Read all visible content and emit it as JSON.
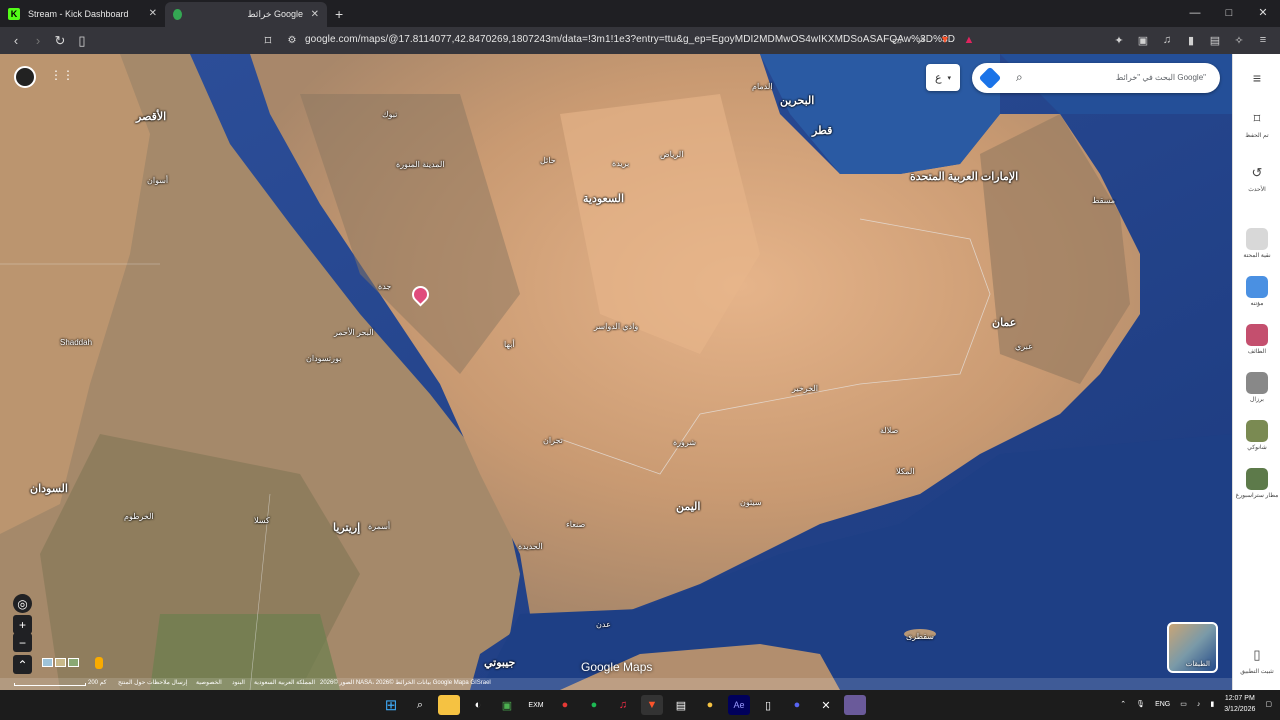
{
  "browser": {
    "tabs": [
      {
        "title": "Stream - Kick Dashboard",
        "favicon": "kick-icon",
        "active": false
      },
      {
        "title": "خرائط Google",
        "favicon": "google-maps-icon",
        "active": true
      }
    ],
    "new_tab": "+",
    "window_controls": {
      "minimize": "—",
      "maximize": "□",
      "close": "✕"
    },
    "url": "google.com/maps/@17.8114077,42.8470269,1807243m/data=!3m1!1e3?entry=ttu&g_ep=EgoyMDI2MDMwOS4wIKXMDSoASAFQAw%3D%3D"
  },
  "maps": {
    "search_placeholder": "البحث في \"خرائط Google\"",
    "lang_chip": "ع",
    "brand": "Google Maps",
    "layers_label": "الطبقات",
    "footer": {
      "scale": "200 كم",
      "imagery": "الصور ©2026 NASA، بيانات الخرائط ©2026 Google Mapa GISrael",
      "terms": "المملكة العربية السعودية",
      "terms2": "البنود",
      "privacy": "الخصوصية",
      "feedback": "إرسال ملاحظات حول المنتج"
    },
    "labels": {
      "saudi": "السعودية",
      "uae": "الإمارات العربية المتحدة",
      "oman": "عمان",
      "yemen": "اليمن",
      "sudan": "السودان",
      "eritrea": "إريتريا",
      "bahrain": "البحرين",
      "qatar": "قطر",
      "riyadh": "الرياض",
      "medina": "المدينة المنورة",
      "dammam": "الدمام",
      "muscat": "مسقط",
      "sanaa": "صنعاء",
      "aden": "عدن",
      "khartoum": "الخرطوم",
      "asmara": "أسمرة",
      "djibouti": "جيبوتي",
      "redsea": "البحر الأحمر",
      "luxor": "الأقصر",
      "aswan": "أسوان",
      "portsudan": "بورتسودان",
      "jeddah": "جدة",
      "abha": "أبها",
      "najran": "نجران",
      "salalah": "صلالة",
      "mukalla": "المكلا",
      "shaddah": "Shaddah",
      "socotra": "سقطرى",
      "hodeidah": "الحديدة",
      "seiyun": "سيئون",
      "ibri": "عبري",
      "sharurah": "شرورة",
      "wadi": "وادي الدواسر",
      "kharkhir": "الخرخير",
      "tabuk": "تبوك",
      "hail": "حائل",
      "buraydah": "بريدة",
      "kassala": "كسلا"
    }
  },
  "sidebar": {
    "menu": "≡",
    "items": [
      {
        "label": "تم الحفظ",
        "icon": "bookmark-icon"
      },
      {
        "label": "الأحدث",
        "icon": "history-icon"
      },
      {
        "label": "نقية المحتة",
        "icon": "app-icon"
      },
      {
        "label": "مؤتنه",
        "icon": "app-icon"
      },
      {
        "label": "الطائف",
        "icon": "app-icon"
      },
      {
        "label": "برزال",
        "icon": "app-icon"
      },
      {
        "label": "شانوكي",
        "icon": "app-icon"
      },
      {
        "label": "مطار ستراسبورغ",
        "icon": "app-icon"
      },
      {
        "label": "تثبيت التطبيق",
        "icon": "install-icon"
      }
    ]
  },
  "taskbar": {
    "lang": "ENG",
    "time": "12:07 PM",
    "date": "3/12/2026"
  }
}
